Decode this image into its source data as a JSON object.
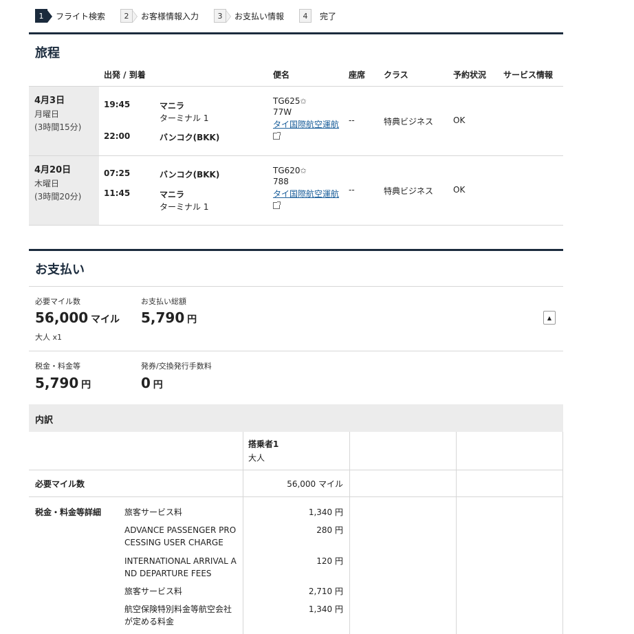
{
  "steps": [
    {
      "num": "1",
      "label": "フライト検索"
    },
    {
      "num": "2",
      "label": "お客様情報入力"
    },
    {
      "num": "3",
      "label": "お支払い情報"
    },
    {
      "num": "4",
      "label": "完了"
    }
  ],
  "itinerary": {
    "title": "旅程",
    "headers": {
      "depart_arrive": "出発 / 到着",
      "flight": "便名",
      "seat": "座席",
      "class": "クラス",
      "status": "予約状況",
      "service": "サービス情報"
    },
    "segments": [
      {
        "date": "4月3日",
        "weekday": "月曜日",
        "duration": "(3時間15分)",
        "dep_time": "19:45",
        "dep_place": "マニラ",
        "dep_terminal": "ターミナル 1",
        "arr_time": "22:00",
        "arr_place": "バンコク(BKK)",
        "flight_no": "TG625",
        "aircraft": "77W",
        "airline": "タイ国際航空運航",
        "seat": "--",
        "class": "特典ビジネス",
        "status": "OK"
      },
      {
        "date": "4月20日",
        "weekday": "木曜日",
        "duration": "(3時間20分)",
        "dep_time": "07:25",
        "dep_place": "バンコク(BKK)",
        "arr_time": "11:45",
        "arr_place": "マニラ",
        "arr_terminal": "ターミナル 1",
        "flight_no": "TG620",
        "aircraft": "788",
        "airline": "タイ国際航空運航",
        "seat": "--",
        "class": "特典ビジネス",
        "status": "OK"
      }
    ]
  },
  "payment": {
    "title": "お支払い",
    "miles_label": "必要マイル数",
    "miles_value": "56,000",
    "miles_unit": "マイル",
    "pax_note": "大人 x1",
    "total_label": "お支払い総額",
    "total_value": "5,790",
    "total_unit": "円",
    "tax_label": "税金・料金等",
    "tax_value": "5,790",
    "tax_unit": "円",
    "fee_label": "発券/交換発行手数料",
    "fee_value": "0",
    "fee_unit": "円"
  },
  "breakdown": {
    "title": "内訳",
    "passenger_header": "搭乗者1",
    "passenger_type": "大人",
    "miles_row_label": "必要マイル数",
    "miles_row_value": "56,000 マイル",
    "tax_detail_label": "税金・料金等詳細",
    "tax_items": [
      {
        "name": "旅客サービス料",
        "amount": "1,340 円"
      },
      {
        "name": "ADVANCE PASSENGER PROCESSING USER CHARGE",
        "amount": "280 円"
      },
      {
        "name": "INTERNATIONAL ARRIVAL AND DEPARTURE FEES",
        "amount": "120 円"
      },
      {
        "name": "旅客サービス料",
        "amount": "2,710 円"
      },
      {
        "name": "航空保険特別料金等航空会社が定める料金",
        "amount": "1,340 円"
      }
    ]
  }
}
